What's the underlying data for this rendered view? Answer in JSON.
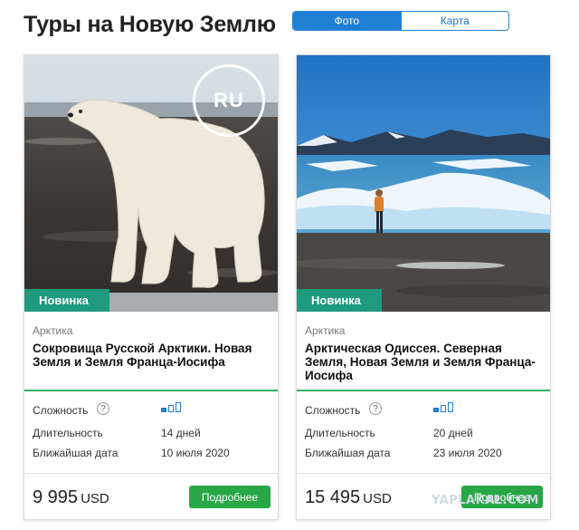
{
  "header": {
    "title": "Туры на Новую Землю",
    "toggle": {
      "photo": "Фото",
      "map": "Карта",
      "active": "photo"
    }
  },
  "cards": [
    {
      "image_icon": "polar-bear-photo",
      "ru_badge": "RU",
      "badge": "Новинка",
      "region": "Арктика",
      "title": "Сокровища Русской Арктики. Новая Земля и Земля Франца-Иосифа",
      "difficulty_label": "Сложность",
      "difficulty_level": 1,
      "difficulty_max": 3,
      "duration_label": "Длительность",
      "duration": "14 дней",
      "date_label": "Ближайшая дата",
      "date": "10 июля 2020",
      "price": "9 995",
      "currency": "USD",
      "button": "Подробнее"
    },
    {
      "image_icon": "arctic-explorer-photo",
      "badge": "Новинка",
      "region": "Арктика",
      "title": "Арктическая Одиссея. Северная Земля, Новая Земля и Земля Франца-Иосифа",
      "difficulty_label": "Сложность",
      "difficulty_level": 1,
      "difficulty_max": 3,
      "duration_label": "Длительность",
      "duration": "20 дней",
      "date_label": "Ближайшая дата",
      "date": "23 июля 2020",
      "price": "15 495",
      "currency": "USD",
      "button": "Подробнее"
    }
  ],
  "watermark": "YAPLAKAL.COM",
  "colors": {
    "accent_blue": "#1f7fd3",
    "badge_green": "#1e9a7e",
    "button_green": "#27a745",
    "divider_green": "#28b463"
  }
}
